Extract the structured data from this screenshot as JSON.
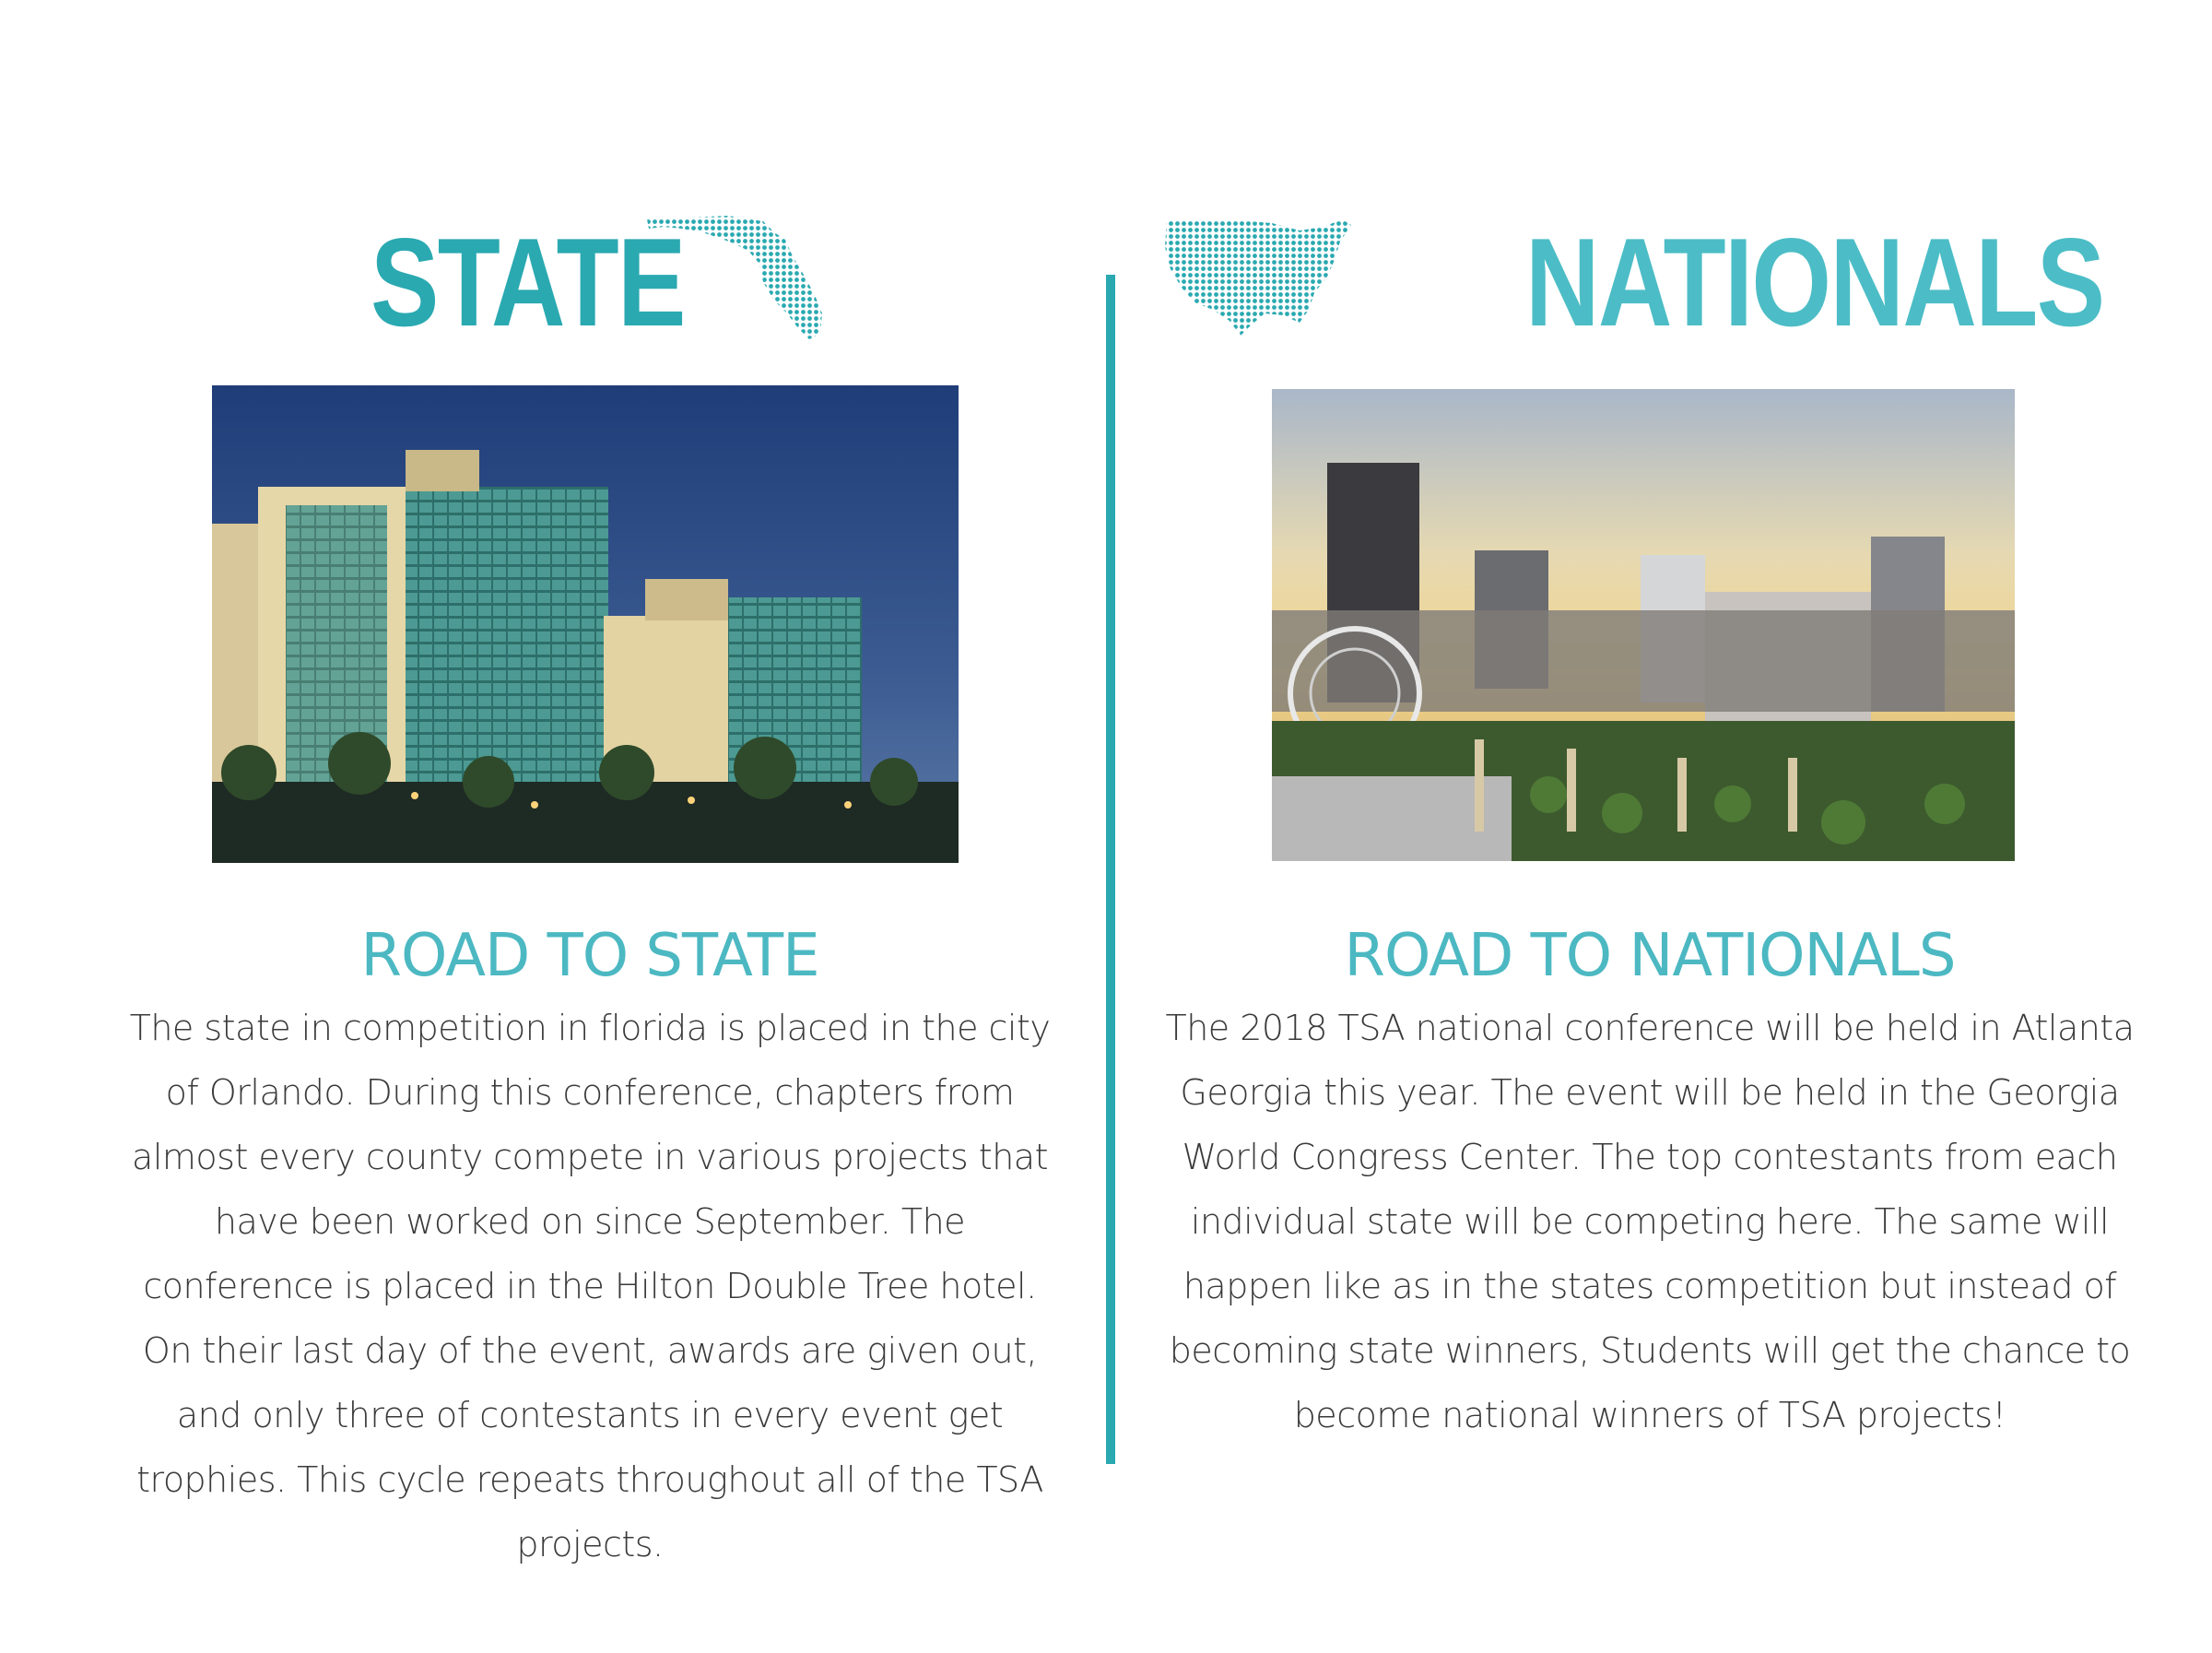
{
  "colors": {
    "accent": "#2aa9b1",
    "accent_light": "#4cbdc6",
    "text": "#3a3a3a"
  },
  "state": {
    "heading": "STATE",
    "icon": "florida-map-icon",
    "subheading": "ROAD TO STATE",
    "body": "The state in competition in florida is placed in the city of  Orlando. During this conference, chapters from almost every county compete in various projects that have been worked on since September. The conference is placed in the Hilton Double Tree hotel. On their last day of the event, awards are given out, and only three of contestants in every event get trophies. This cycle repeats throughout all of the TSA projects."
  },
  "nationals": {
    "heading": "NATIONALS",
    "icon": "usa-map-icon",
    "subheading": "ROAD TO NATIONALS",
    "body": "The 2018 TSA national conference will be held in Atlanta Georgia this year. The event will be held in the Georgia World Congress Center. The top contestants from each individual state will be competing here. The same will happen like as in the states competition but instead of becoming state winners, Students will get the chance to become national winners of TSA projects!"
  }
}
